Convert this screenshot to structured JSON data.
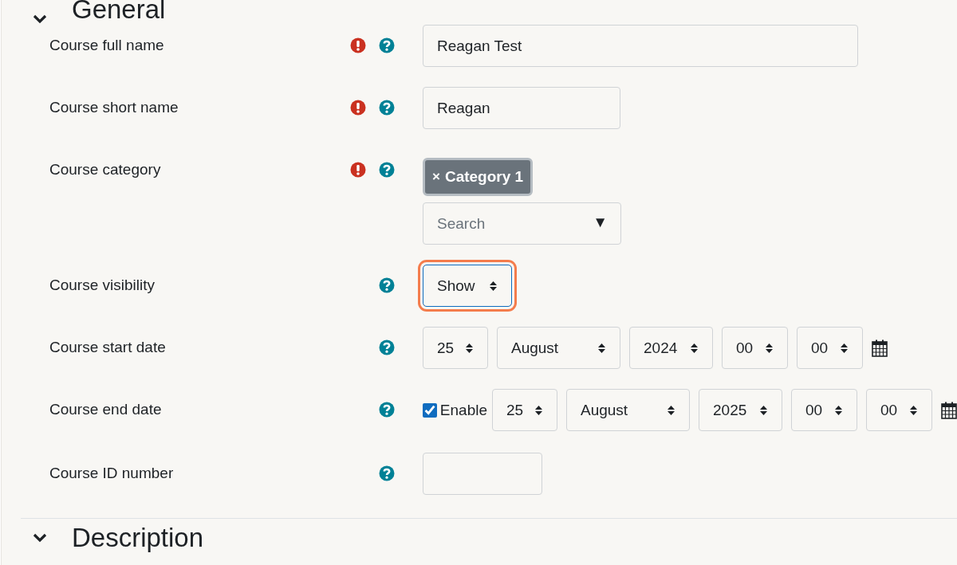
{
  "sections": [
    {
      "title": "General"
    },
    {
      "title": "Description"
    }
  ],
  "fields": [
    {
      "kind": "text",
      "label": "Course full name",
      "required": true,
      "help": true,
      "value": "Reagan Test"
    },
    {
      "kind": "text",
      "label": "Course short name",
      "required": true,
      "help": true,
      "value": "Reagan"
    },
    {
      "kind": "autocomplete",
      "label": "Course category",
      "required": true,
      "help": true,
      "chips": [
        {
          "remove": "×",
          "label": "Category 1"
        }
      ],
      "placeholder": "Search",
      "arrow": "▼"
    },
    {
      "kind": "select",
      "label": "Course visibility",
      "required": false,
      "help": true,
      "value": "Show",
      "focused": true
    },
    {
      "kind": "datetime",
      "label": "Course start date",
      "required": false,
      "help": true,
      "parts": [
        "25",
        "August",
        "2024",
        "00",
        "00"
      ]
    },
    {
      "kind": "datetime",
      "label": "Course end date",
      "required": false,
      "help": true,
      "enable": {
        "label": "Enable",
        "checked": true
      },
      "parts": [
        "25",
        "August",
        "2025",
        "00",
        "00"
      ]
    },
    {
      "kind": "text",
      "label": "Course ID number",
      "required": false,
      "help": true
    }
  ]
}
